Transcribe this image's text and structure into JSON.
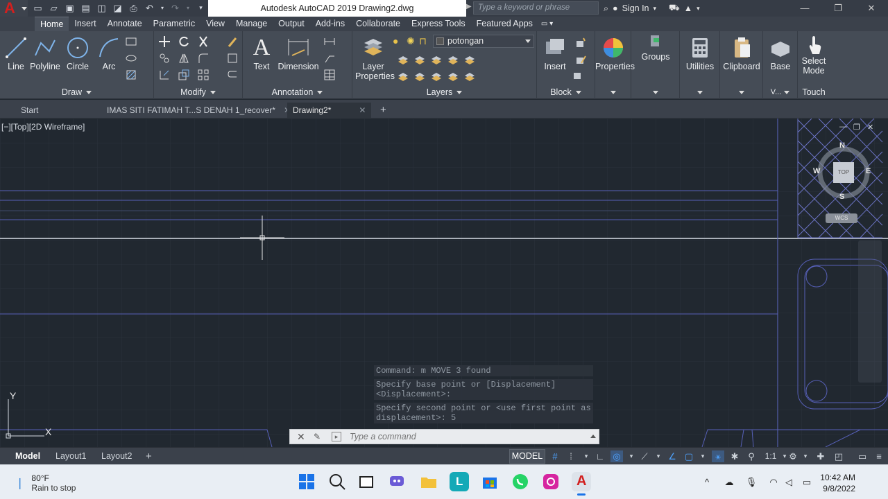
{
  "window": {
    "title": "Autodesk AutoCAD 2019    Drawing2.dwg",
    "search_placeholder": "Type a keyword or phrase",
    "sign_in": "Sign In"
  },
  "ribbon_tabs": [
    {
      "label": "Home",
      "active": true
    },
    {
      "label": "Insert"
    },
    {
      "label": "Annotate"
    },
    {
      "label": "Parametric"
    },
    {
      "label": "View"
    },
    {
      "label": "Manage"
    },
    {
      "label": "Output"
    },
    {
      "label": "Add-ins"
    },
    {
      "label": "Collaborate"
    },
    {
      "label": "Express Tools"
    },
    {
      "label": "Featured Apps"
    }
  ],
  "ribbon": {
    "draw": {
      "label": "Draw",
      "line": "Line",
      "polyline": "Polyline",
      "circle": "Circle",
      "arc": "Arc"
    },
    "modify": {
      "label": "Modify"
    },
    "annotation": {
      "label": "Annotation",
      "text": "Text",
      "dimension": "Dimension"
    },
    "layers": {
      "label": "Layers",
      "layer_properties": "Layer\nProperties",
      "current_layer": "potongan"
    },
    "block": {
      "label": "Block",
      "insert": "Insert"
    },
    "properties": "Properties",
    "groups": "Groups",
    "utilities": "Utilities",
    "clipboard": "Clipboard",
    "view": {
      "base": "Base",
      "label": "V..."
    },
    "touch": {
      "select_mode": "Select\nMode",
      "label": "Touch"
    }
  },
  "file_tabs": [
    {
      "label": "Start"
    },
    {
      "label": "IMAS SITI FATIMAH T...S DENAH 1_recover*"
    },
    {
      "label": "Drawing2*",
      "active": true
    }
  ],
  "viewport": {
    "label": "[−][Top][2D Wireframe]",
    "viewcube": {
      "n": "N",
      "s": "S",
      "e": "E",
      "w": "W",
      "top": "TOP",
      "wcs": "WCS"
    },
    "ucs": {
      "x": "X",
      "y": "Y"
    }
  },
  "command": {
    "history": [
      "Command: m MOVE 3 found",
      "Specify base point or [Displacement]\n<Displacement>:",
      "Specify second point or <use first point as\ndisplacement>: 5"
    ],
    "placeholder": "Type a command"
  },
  "layout_tabs": [
    {
      "label": "Model",
      "active": true
    },
    {
      "label": "Layout1"
    },
    {
      "label": "Layout2"
    }
  ],
  "status": {
    "model": "MODEL",
    "scale": "1:1"
  },
  "taskbar": {
    "temp": "80°F",
    "weather": "Rain to stop",
    "time": "10:42 AM",
    "date": "9/8/2022"
  },
  "colors": {
    "canvas": "#212830",
    "ribbon": "#454c56",
    "accent": "#4ea3ff",
    "autocad_red": "#d2201f"
  }
}
